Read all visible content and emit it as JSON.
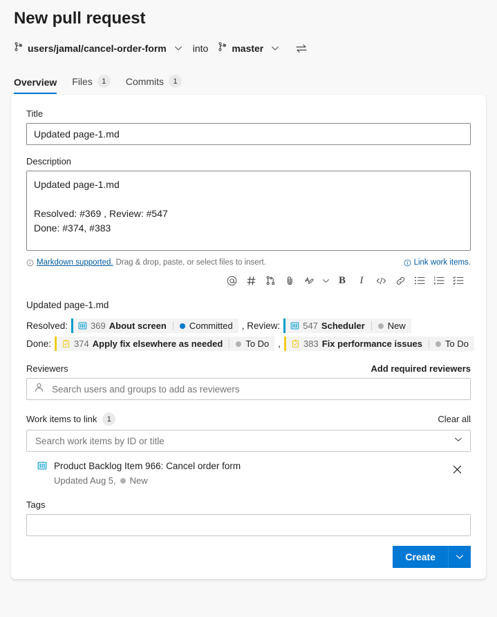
{
  "header": {
    "title": "New pull request",
    "source_branch": "users/jamal/cancel-order-form",
    "into_label": "into",
    "target_branch": "master",
    "swap_icon": "swap-branches-icon"
  },
  "tabs": [
    {
      "label": "Overview",
      "count": "",
      "active": true
    },
    {
      "label": "Files",
      "count": "1",
      "active": false
    },
    {
      "label": "Commits",
      "count": "1",
      "active": false
    }
  ],
  "form": {
    "title_label": "Title",
    "title_value": "Updated page-1.md",
    "title_placeholder": "",
    "description_label": "Description",
    "description_value": "Updated page-1.md\n\nResolved: #369 , Review: #547\nDone: #374, #383",
    "helper_link": "Markdown supported.",
    "helper_text": "Drag & drop, paste, or select files to insert.",
    "link_work_items": "Link work items."
  },
  "toolbar": [
    {
      "name": "mention-icon",
      "glyph": "@"
    },
    {
      "name": "work-item-hash-icon",
      "glyph": "#"
    },
    {
      "name": "pull-request-icon",
      "glyph": ""
    },
    {
      "name": "attachment-icon",
      "glyph": ""
    },
    {
      "name": "highlight-icon",
      "glyph": ""
    },
    {
      "name": "chevron-down-icon",
      "glyph": ""
    },
    {
      "name": "bold-icon",
      "glyph": "B"
    },
    {
      "name": "italic-icon",
      "glyph": "I"
    },
    {
      "name": "code-icon",
      "glyph": "</>"
    },
    {
      "name": "link-icon",
      "glyph": ""
    },
    {
      "name": "bullet-list-icon",
      "glyph": ""
    },
    {
      "name": "numbered-list-icon",
      "glyph": ""
    },
    {
      "name": "task-list-icon",
      "glyph": ""
    }
  ],
  "preview": {
    "title": "Updated page-1.md",
    "lines": [
      {
        "prefix": "Resolved:",
        "items": [
          {
            "type": "Product Backlog Item",
            "icon": "product-backlog-item-icon",
            "accent": "#009ccc",
            "id": "369",
            "title": "About screen",
            "state": "Committed",
            "state_color": "#007acc"
          }
        ],
        "separator": ", Review:",
        "items2": [
          {
            "type": "Product Backlog Item",
            "icon": "product-backlog-item-icon",
            "accent": "#009ccc",
            "id": "547",
            "title": "Scheduler",
            "state": "New",
            "state_color": "#b2b2b2"
          }
        ]
      },
      {
        "prefix": "Done:",
        "items": [
          {
            "type": "Task",
            "icon": "task-icon",
            "accent": "#f2cb1d",
            "id": "374",
            "title": "Apply fix elsewhere as needed",
            "state": "To Do",
            "state_color": "#b2b2b2"
          }
        ],
        "separator": ",",
        "items2": [
          {
            "type": "Task",
            "icon": "task-icon",
            "accent": "#f2cb1d",
            "id": "383",
            "title": "Fix performance issues",
            "state": "To Do",
            "state_color": "#b2b2b2"
          }
        ]
      }
    ]
  },
  "reviewers": {
    "label": "Reviewers",
    "action": "Add required reviewers",
    "placeholder": "Search users and groups to add as reviewers",
    "value": ""
  },
  "work_items": {
    "label": "Work items to link",
    "count": "1",
    "action": "Clear all",
    "placeholder": "Search work items by ID or title",
    "value": "",
    "linked": [
      {
        "icon": "product-backlog-item-icon",
        "title": "Product Backlog Item 966: Cancel order form",
        "updated": "Updated Aug 5,",
        "state": "New",
        "state_color": "#b2b2b2"
      }
    ]
  },
  "tags": {
    "label": "Tags",
    "value": "",
    "placeholder": ""
  },
  "footer": {
    "create_label": "Create",
    "create_color": "#0078d4",
    "chevron_icon": "chevron-down-icon"
  }
}
